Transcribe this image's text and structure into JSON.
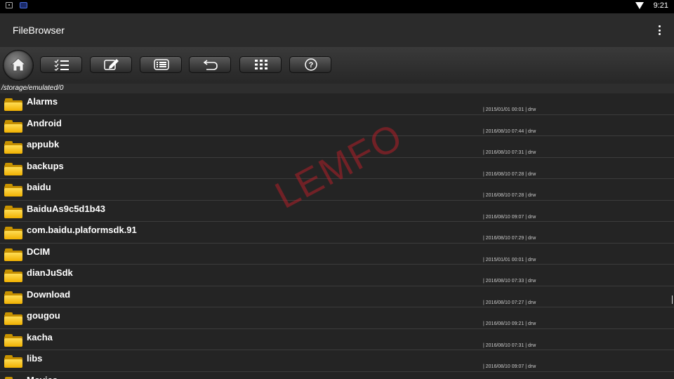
{
  "status_bar": {
    "time": "9:21"
  },
  "app": {
    "title": "FileBrowser"
  },
  "toolbar": {
    "buttons": [
      {
        "icon": "home-icon"
      },
      {
        "icon": "checklist-icon"
      },
      {
        "icon": "edit-icon"
      },
      {
        "icon": "list-icon"
      },
      {
        "icon": "back-arrow-icon"
      },
      {
        "icon": "grid-icon"
      },
      {
        "icon": "help-icon"
      }
    ]
  },
  "path": "/storage/emulated/0",
  "files": [
    {
      "name": "Alarms",
      "meta": "| 2015/01/01 00:01 | drw"
    },
    {
      "name": "Android",
      "meta": "| 2016/08/10 07:44 | drw"
    },
    {
      "name": "appubk",
      "meta": "| 2016/08/10 07:31 | drw"
    },
    {
      "name": "backups",
      "meta": "| 2016/08/10 07:28 | drw"
    },
    {
      "name": "baidu",
      "meta": "| 2016/08/10 07:28 | drw"
    },
    {
      "name": "BaiduAs9c5d1b43",
      "meta": "| 2016/08/10 09:07 | drw"
    },
    {
      "name": "com.baidu.plaformsdk.91",
      "meta": "| 2016/08/10 07:29 | drw"
    },
    {
      "name": "DCIM",
      "meta": "| 2015/01/01 00:01 | drw"
    },
    {
      "name": "dianJuSdk",
      "meta": "| 2016/08/10 07:33 | drw"
    },
    {
      "name": "Download",
      "meta": "| 2016/08/10 07:27 | drw"
    },
    {
      "name": "gougou",
      "meta": "| 2016/08/10 09:21 | drw"
    },
    {
      "name": "kacha",
      "meta": "| 2016/08/10 07:31 | drw"
    },
    {
      "name": "libs",
      "meta": "| 2016/08/10 09:07 | drw"
    },
    {
      "name": "Movies",
      "meta": ""
    }
  ],
  "watermark": "LEMFO",
  "colors": {
    "folder": "#f5c21a",
    "watermark": "#be1e28"
  }
}
